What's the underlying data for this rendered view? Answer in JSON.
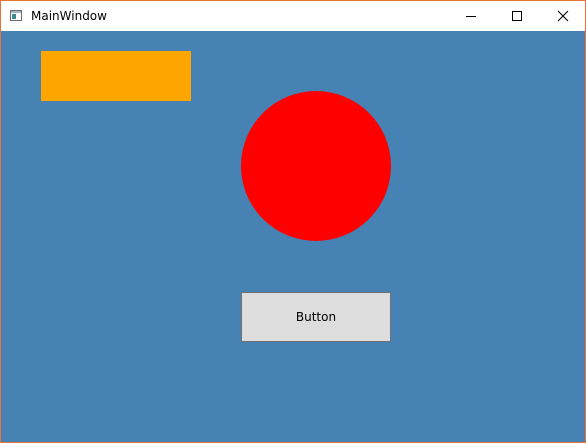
{
  "window": {
    "title": "MainWindow",
    "border_color": "#e8733a",
    "background_color": "#4682b4"
  },
  "titlebar": {
    "icons": {
      "app": "app-window-icon",
      "minimize": "minimize-icon",
      "maximize": "maximize-icon",
      "close": "close-icon"
    }
  },
  "content": {
    "rectangle_color": "#ffa500",
    "circle_color": "#ff0000",
    "button": {
      "label": "Button",
      "background": "#dddddd",
      "border": "#707070"
    }
  }
}
